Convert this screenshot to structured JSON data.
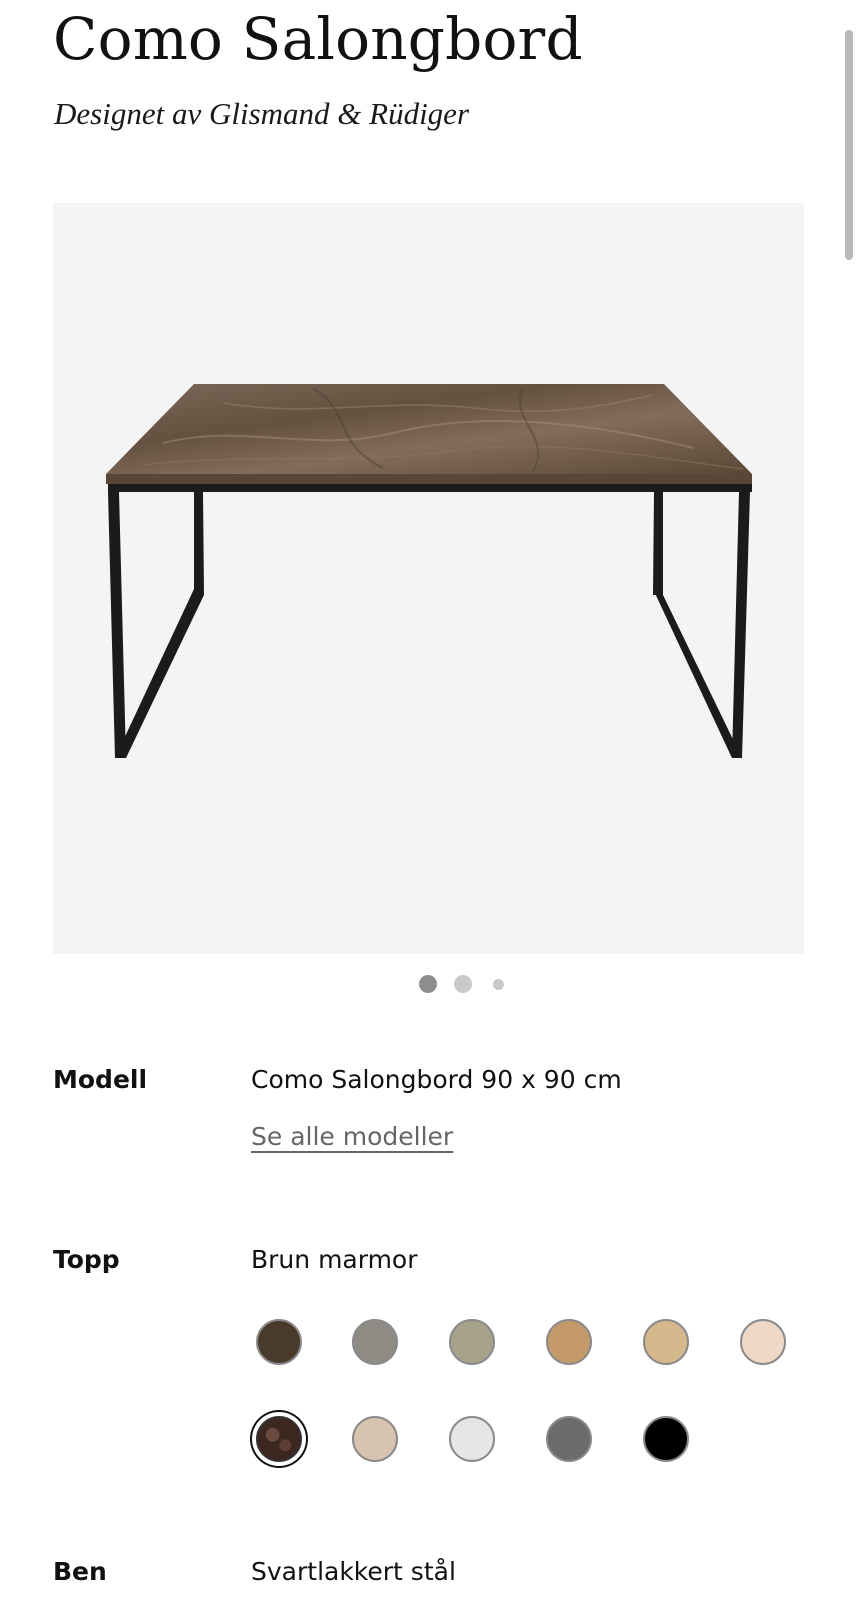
{
  "product": {
    "title": "Como Salongbord",
    "subtitle": "Designet av Glismand & Rüdiger"
  },
  "gallery": {
    "image_icon": "coffee-table-photo",
    "slides": 3,
    "active_slide": 1,
    "background": "#f4f4f4"
  },
  "model": {
    "label": "Modell",
    "value": "Como Salongbord 90 x 90 cm",
    "link": "Se alle modeller"
  },
  "top": {
    "label": "Topp",
    "value": "Brun marmor",
    "swatches": [
      {
        "name": "dark-walnut",
        "color": "#4a3a2c"
      },
      {
        "name": "grey-stone",
        "color": "#8f8c85"
      },
      {
        "name": "sage-stone",
        "color": "#a7a28a"
      },
      {
        "name": "oak",
        "color": "#c59a6a"
      },
      {
        "name": "light-oak",
        "color": "#d5b98c"
      },
      {
        "name": "light-rose",
        "color": "#efd8c6"
      },
      {
        "name": "brown-marble",
        "color": "#3b2620",
        "selected": true
      },
      {
        "name": "beige-marble",
        "color": "#d6c4af"
      },
      {
        "name": "white",
        "color": "#e6e6e4"
      },
      {
        "name": "grey-marble",
        "color": "#6b6b6b"
      },
      {
        "name": "black",
        "color": "#000000"
      }
    ]
  },
  "legs": {
    "label": "Ben",
    "value": "Svartlakkert stål"
  },
  "colors": {
    "marble_top": "#6e5a49",
    "frame": "#1b1b1b",
    "dot_active": "#8f8f8f",
    "dot_inactive": "#c9c9c9"
  }
}
